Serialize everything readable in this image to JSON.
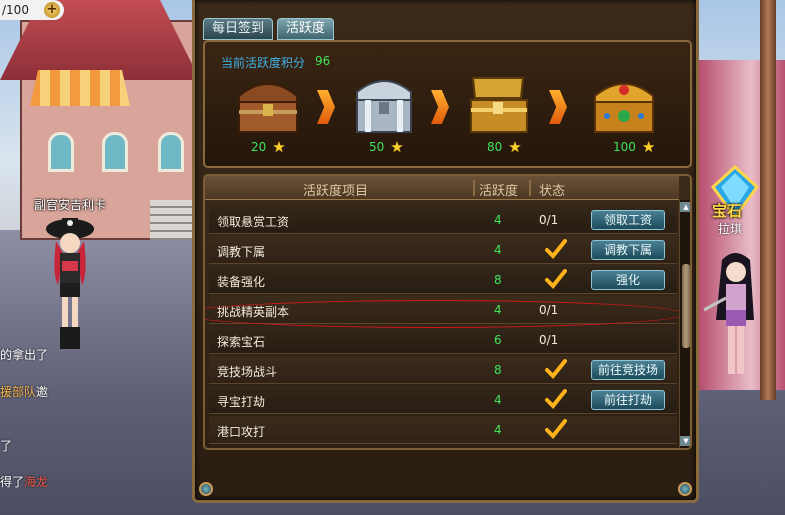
{
  "hud": {
    "counter": "/100",
    "add_symbol": "+"
  },
  "scene": {
    "npc_name": "副官安吉利卡",
    "chat_lines": [
      {
        "text": "的拿出了"
      },
      {
        "text": "援部队",
        "extra": "邀"
      },
      {
        "text": "了"
      },
      {
        "text": "得了",
        "extra": "海龙"
      }
    ],
    "gem": {
      "label": "宝石",
      "sub": "拉琪"
    }
  },
  "panel": {
    "tabs": [
      {
        "label": "每日签到",
        "active": false
      },
      {
        "label": "活跃度",
        "active": true
      }
    ],
    "score_label": "当前活跃度积分",
    "score_value": "96",
    "tiers": [
      {
        "points": "20",
        "chest": "wooden-chest"
      },
      {
        "points": "50",
        "chest": "silver-chest"
      },
      {
        "points": "80",
        "chest": "gold-chest"
      },
      {
        "points": "100",
        "chest": "jeweled-chest"
      }
    ],
    "table_headers": {
      "item": "活跃度项目",
      "points": "活跃度",
      "status": "状态"
    },
    "rows": [
      {
        "name": "领取悬赏工资",
        "points": "4",
        "status": "0/1",
        "done": false,
        "button": "领取工资"
      },
      {
        "name": "调教下属",
        "points": "4",
        "status": "",
        "done": true,
        "button": "调教下属"
      },
      {
        "name": "装备强化",
        "points": "8",
        "status": "",
        "done": true,
        "button": "强化"
      },
      {
        "name": "挑战精英副本",
        "points": "4",
        "status": "0/1",
        "done": false,
        "button": ""
      },
      {
        "name": "探索宝石",
        "points": "6",
        "status": "0/1",
        "done": false,
        "button": ""
      },
      {
        "name": "竞技场战斗",
        "points": "8",
        "status": "",
        "done": true,
        "button": "前往竞技场"
      },
      {
        "name": "寻宝打劫",
        "points": "4",
        "status": "",
        "done": true,
        "button": "前往打劫"
      },
      {
        "name": "港口攻打",
        "points": "4",
        "status": "",
        "done": true,
        "button": ""
      }
    ],
    "colors": {
      "accent_green": "#3fe35a",
      "accent_blue": "#3fb3ea",
      "highlight_red": "#d01818",
      "star": "#ffd02a"
    }
  }
}
